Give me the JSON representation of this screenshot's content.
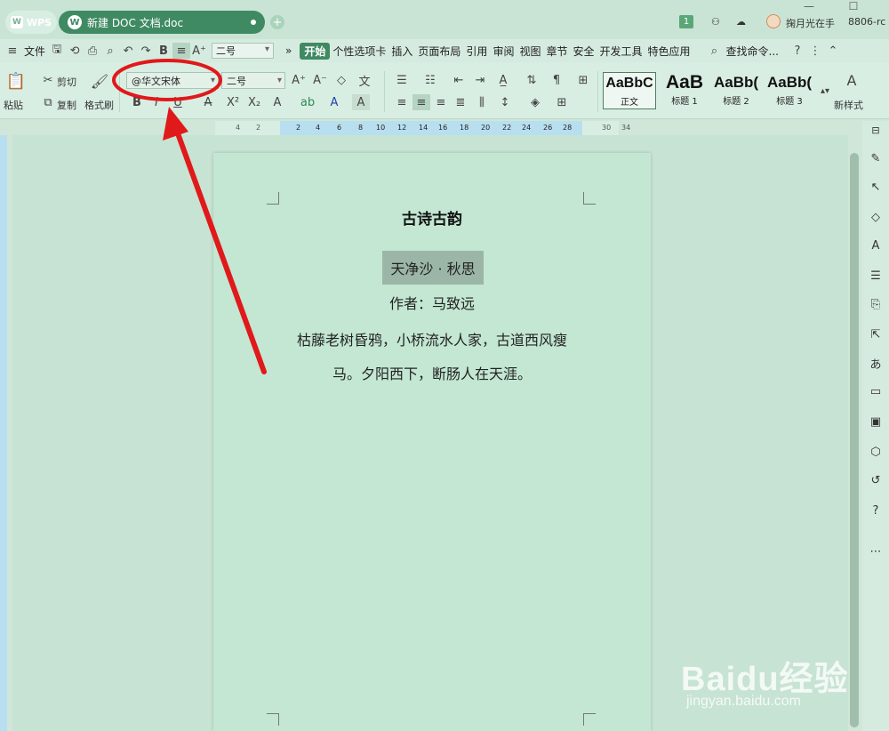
{
  "titlebar": {
    "wps_label": "WPS",
    "doc_tab_label": "新建 DOC 文档.doc",
    "badge_count": "1",
    "username": "掬月光在手",
    "build_code": "8806-rc"
  },
  "menubar": {
    "file": "文件",
    "size_select": "二号",
    "more": "»",
    "tabs": [
      "开始",
      "个性选项卡",
      "插入",
      "页面布局",
      "引用",
      "审阅",
      "视图",
      "章节",
      "安全",
      "开发工具",
      "特色应用"
    ],
    "search_placeholder": "查找命令..."
  },
  "ribbon": {
    "cut": "剪切",
    "paste": "粘贴",
    "copy": "复制",
    "format_painter": "格式刷",
    "font_name": "@华文宋体",
    "font_size": "二号",
    "styles": [
      {
        "sample": "AaBbC",
        "name": "正文"
      },
      {
        "sample": "AaB",
        "name": "标题 1"
      },
      {
        "sample": "AaBb(",
        "name": "标题 2"
      },
      {
        "sample": "AaBb(",
        "name": "标题 3"
      }
    ],
    "new_style": "新样式"
  },
  "ruler": {
    "ticks": [
      "4",
      "2",
      "2",
      "4",
      "6",
      "8",
      "10",
      "12",
      "14",
      "16",
      "18",
      "20",
      "22",
      "24",
      "26",
      "28",
      "30",
      "32",
      "34"
    ]
  },
  "document": {
    "title": "古诗古韵",
    "poem_title": "天净沙 · 秋思",
    "author": "作者：马致远",
    "lines": [
      "枯藤老树昏鸦，小桥流水人家，古道西风瘦",
      "马。夕阳西下，断肠人在天涯。"
    ]
  },
  "watermark": {
    "brand": "Baidu经验",
    "url": "jingyan.baidu.com"
  },
  "colors": {
    "accent": "#3f8a63",
    "annotation": "#e0191b"
  }
}
